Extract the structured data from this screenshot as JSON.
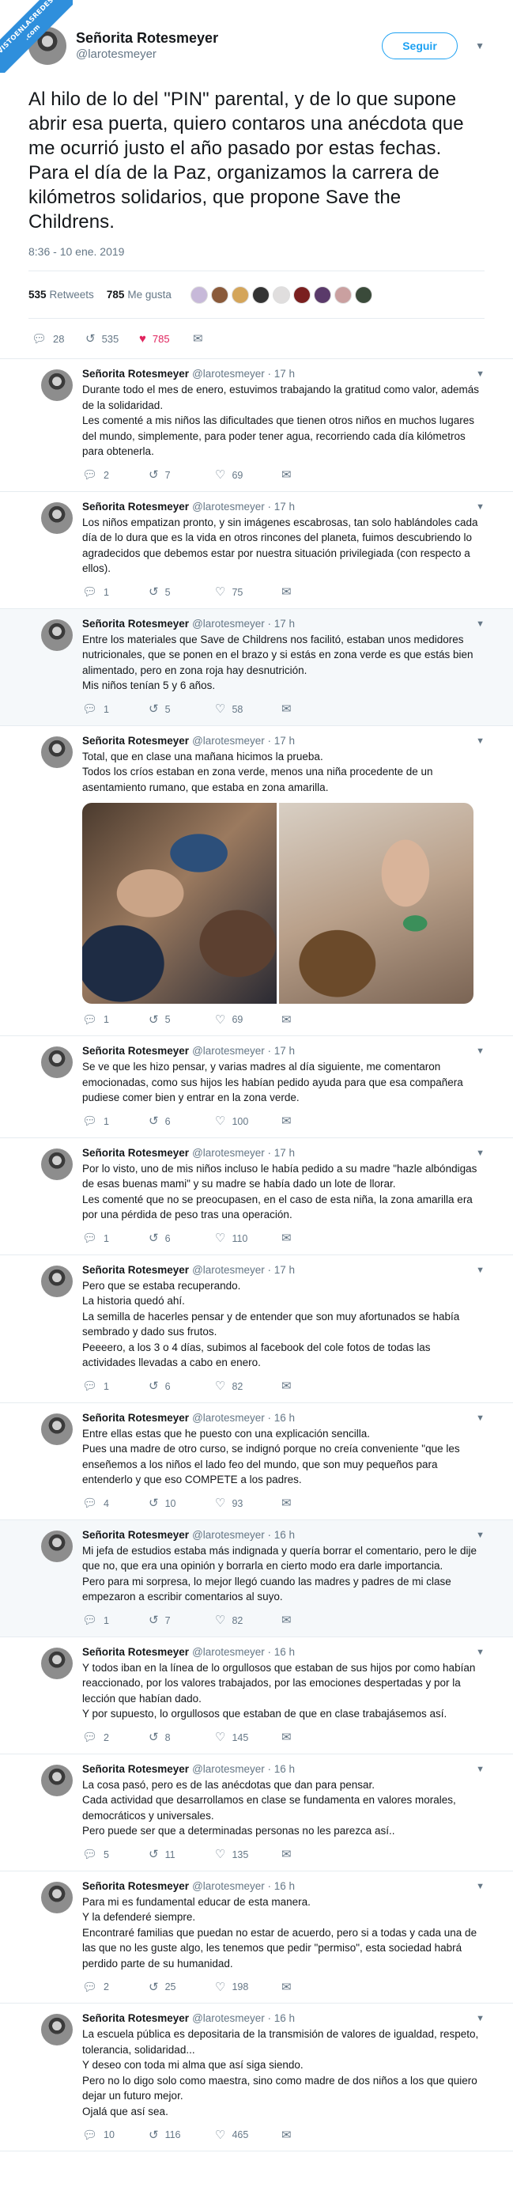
{
  "watermark": {
    "line1": "VISTOENLASREDES",
    "line2": ".com"
  },
  "main": {
    "name": "Señorita Rotesmeyer",
    "handle": "@larotesmeyer",
    "follow_label": "Seguir",
    "text": "Al hilo de lo del \"PIN\" parental, y de lo que supone abrir esa puerta, quiero contaros una anécdota que me ocurrió justo el año pasado por estas fechas. Para el día de la Paz, organizamos la carrera de kilómetros solidarios, que propone Save the Childrens.",
    "time": "8:36 - 10 ene. 2019",
    "retweets_count": "535",
    "retweets_label": "Retweets",
    "likes_count": "785",
    "likes_label": "Me gusta",
    "actions": {
      "replies": "28",
      "retweets": "535",
      "likes": "785"
    },
    "liker_colors": [
      "#c7b9d9",
      "#8a5a3a",
      "#d4a55a",
      "#333333",
      "#e0dede",
      "#7a1f1f",
      "#5a3a6a",
      "#caa0a0",
      "#3a4a3a"
    ]
  },
  "icons": {
    "reply": "reply-icon",
    "retweet": "retweet-icon",
    "like": "heart-icon",
    "dm": "envelope-icon"
  },
  "replies": [
    {
      "name": "Señorita Rotesmeyer",
      "meta": "@larotesmeyer · 17 h",
      "text": "Durante todo el mes de enero, estuvimos trabajando la gratitud como valor, además de la solidaridad.\nLes comenté a mis niños las dificultades que tienen otros niños en muchos lugares del mundo, simplemente, para poder tener agua, recorriendo cada día kilómetros para obtenerla.",
      "replies": "2",
      "retweets": "7",
      "likes": "69",
      "alt": false
    },
    {
      "name": "Señorita Rotesmeyer",
      "meta": "@larotesmeyer · 17 h",
      "text": "Los niños empatizan pronto, y sin imágenes escabrosas, tan solo hablándoles cada día de lo dura que es la vida en otros rincones del planeta, fuimos descubriendo lo agradecidos que debemos estar por nuestra situación privilegiada (con respecto a ellos).",
      "replies": "1",
      "retweets": "5",
      "likes": "75",
      "alt": false
    },
    {
      "name": "Señorita Rotesmeyer",
      "meta": "@larotesmeyer · 17 h",
      "text": "Entre los materiales que Save de Childrens nos facilitó, estaban unos medidores nutricionales, que se ponen en el brazo y si estás en zona verde es que estás bien alimentado, pero en zona roja hay desnutrición.\nMis niños tenían 5 y 6 años.",
      "replies": "1",
      "retweets": "5",
      "likes": "58",
      "alt": true
    },
    {
      "name": "Señorita Rotesmeyer",
      "meta": "@larotesmeyer · 17 h",
      "text": "Total, que en clase una mañana hicimos la prueba.\nTodos los críos estaban en zona verde, menos una niña procedente de un asentamiento rumano, que estaba en zona amarilla.",
      "replies": "1",
      "retweets": "5",
      "likes": "69",
      "alt": false,
      "photos": true
    },
    {
      "name": "Señorita Rotesmeyer",
      "meta": "@larotesmeyer · 17 h",
      "text": "Se ve que les hizo pensar, y varias madres al día siguiente, me comentaron emocionadas, como sus hijos les habían pedido ayuda para que esa compañera pudiese comer bien y entrar en la zona verde.",
      "replies": "1",
      "retweets": "6",
      "likes": "100",
      "alt": false
    },
    {
      "name": "Señorita Rotesmeyer",
      "meta": "@larotesmeyer · 17 h",
      "text": "Por lo visto, uno de mis niños incluso le había pedido a su madre \"hazle albóndigas de esas buenas mami\" y su madre se había dado un lote de llorar.\nLes comenté que no se preocupasen, en el caso de esta niña, la zona amarilla era por una pérdida de peso tras una operación.",
      "replies": "1",
      "retweets": "6",
      "likes": "110",
      "alt": false
    },
    {
      "name": "Señorita Rotesmeyer",
      "meta": "@larotesmeyer · 17 h",
      "text": "Pero que se estaba recuperando.\nLa historia quedó ahí.\nLa semilla de hacerles pensar y de entender que son muy afortunados se había sembrado y dado sus frutos.\nPeeeero, a los 3 o 4 días, subimos al facebook del cole fotos de todas las actividades llevadas a cabo en enero.",
      "replies": "1",
      "retweets": "6",
      "likes": "82",
      "alt": false
    },
    {
      "name": "Señorita Rotesmeyer",
      "meta": "@larotesmeyer · 16 h",
      "text": "Entre ellas estas que he puesto con una explicación sencilla.\nPues una madre de otro curso, se indignó porque no creía conveniente \"que les enseñemos a los niños el lado feo del mundo, que son muy pequeños para entenderlo y que eso COMPETE a los padres.",
      "replies": "4",
      "retweets": "10",
      "likes": "93",
      "alt": false
    },
    {
      "name": "Señorita Rotesmeyer",
      "meta": "@larotesmeyer · 16 h",
      "text": "Mi jefa de estudios estaba más indignada y quería borrar el comentario, pero le dije que no, que era una opinión y borrarla en cierto modo era darle importancia.\nPero para mi sorpresa, lo mejor llegó cuando las madres y padres de mi clase empezaron a escribir comentarios al suyo.",
      "replies": "1",
      "retweets": "7",
      "likes": "82",
      "alt": true
    },
    {
      "name": "Señorita Rotesmeyer",
      "meta": "@larotesmeyer · 16 h",
      "text": "Y todos iban en la línea de lo orgullosos que estaban de sus hijos por como habían reaccionado, por los valores trabajados, por las emociones despertadas y por la lección que habían dado.\nY por supuesto, lo orgullosos que estaban de que en clase trabajásemos así.",
      "replies": "2",
      "retweets": "8",
      "likes": "145",
      "alt": false
    },
    {
      "name": "Señorita Rotesmeyer",
      "meta": "@larotesmeyer · 16 h",
      "text": "La cosa pasó, pero es de las anécdotas que dan para pensar.\nCada actividad que desarrollamos en clase se fundamenta en valores morales, democráticos y universales.\nPero puede ser que a determinadas personas no les parezca así..",
      "replies": "5",
      "retweets": "11",
      "likes": "135",
      "alt": false
    },
    {
      "name": "Señorita Rotesmeyer",
      "meta": "@larotesmeyer · 16 h",
      "text": "Para mi es fundamental educar de esta manera.\nY la defenderé siempre.\nEncontraré familias que puedan no estar de acuerdo, pero si a todas y cada una de las que no les guste algo, les tenemos que pedir \"permiso\", esta sociedad habrá perdido parte de su humanidad.",
      "replies": "2",
      "retweets": "25",
      "likes": "198",
      "alt": false
    },
    {
      "name": "Señorita Rotesmeyer",
      "meta": "@larotesmeyer · 16 h",
      "text": "La escuela pública es depositaria de la transmisión de valores de igualdad, respeto, tolerancia, solidaridad...\nY deseo con toda mi alma que así siga siendo.\nPero no lo digo solo como maestra, sino como madre de dos niños a los que quiero dejar un futuro mejor.\nOjalá que así sea.",
      "replies": "10",
      "retweets": "116",
      "likes": "465",
      "alt": false
    }
  ]
}
